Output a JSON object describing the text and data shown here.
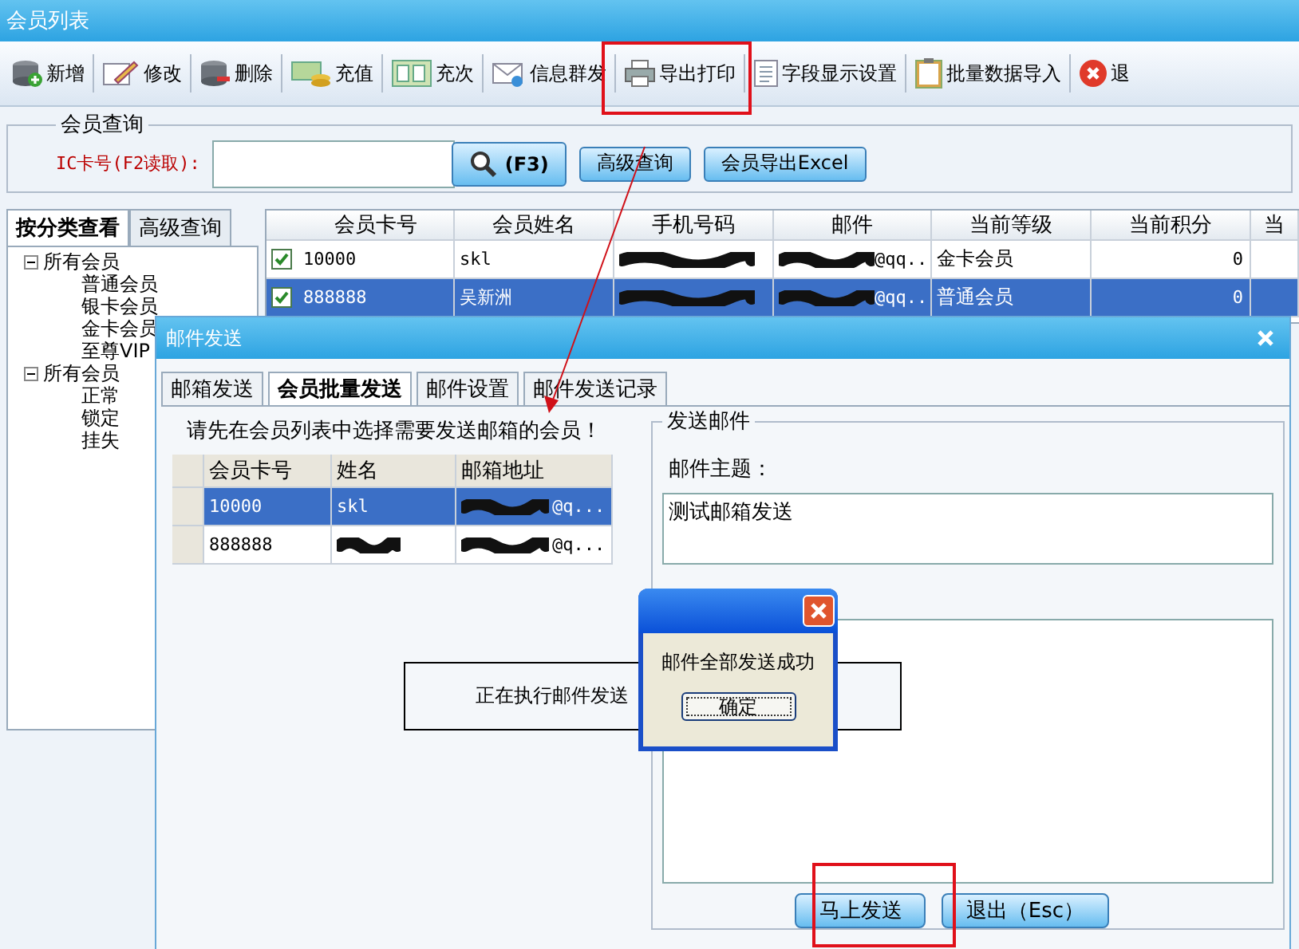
{
  "window": {
    "title": "会员列表"
  },
  "toolbar": [
    {
      "label": "新增",
      "kind": "add"
    },
    {
      "label": "修改",
      "kind": "edit"
    },
    {
      "label": "删除",
      "kind": "delete"
    },
    {
      "label": "充值",
      "kind": "money"
    },
    {
      "label": "充次",
      "kind": "cards"
    },
    {
      "label": "信息群发",
      "kind": "mail"
    },
    {
      "label": "导出打印",
      "kind": "print"
    },
    {
      "label": "字段显示设置",
      "kind": "doc"
    },
    {
      "label": "批量数据导入",
      "kind": "clipboard"
    },
    {
      "label": "退",
      "kind": "exit"
    }
  ],
  "query": {
    "title": "会员查询",
    "ic_label": "IC卡号(F2读取):",
    "search_button": "(F3)",
    "buttons": [
      "高级查询",
      "会员导出Excel"
    ]
  },
  "side_tabs": [
    {
      "label": "按分类查看",
      "selected": true
    },
    {
      "label": "高级查询",
      "selected": false
    }
  ],
  "tree": [
    {
      "label": "所有会员",
      "expanded": true,
      "children": [
        {
          "label": "普通会员"
        },
        {
          "label": "银卡会员"
        },
        {
          "label": "金卡会员"
        },
        {
          "label": "至尊VIP"
        }
      ]
    },
    {
      "label": "所有会员",
      "expanded": true,
      "children": [
        {
          "label": "正常"
        },
        {
          "label": "锁定"
        },
        {
          "label": "挂失"
        }
      ]
    }
  ],
  "table": {
    "columns": [
      "会员卡号",
      "会员姓名",
      "手机号码",
      "邮件",
      "当前等级",
      "当前积分",
      "当"
    ],
    "rows": [
      {
        "checked": true,
        "selected": false,
        "card": "10000",
        "name": "skl",
        "email": "@qq...",
        "level": "金卡会员",
        "points": "0"
      },
      {
        "checked": true,
        "selected": true,
        "card": "888888",
        "name": "吴新洲",
        "email": "@qq...",
        "level": "普通会员",
        "points": "0"
      }
    ]
  },
  "dialog": {
    "title": "邮件发送",
    "tabs": [
      {
        "label": "邮箱发送",
        "selected": false
      },
      {
        "label": "会员批量发送",
        "selected": true
      },
      {
        "label": "邮件设置",
        "selected": false
      },
      {
        "label": "邮件发送记录",
        "selected": false
      }
    ],
    "instruction": "请先在会员列表中选择需要发送邮箱的会员！",
    "grid": {
      "columns": [
        "会员卡号",
        "姓名",
        "邮箱地址"
      ],
      "rows": [
        {
          "selected": true,
          "card": "10000",
          "name": "skl",
          "email": "@q..."
        },
        {
          "selected": false,
          "card": "888888",
          "email": "@q..."
        }
      ]
    },
    "send_group": {
      "title": "发送邮件",
      "subject_label": "邮件主题：",
      "subject": "测试邮箱发送"
    },
    "buttons": [
      "马上发送",
      "退出（Esc）"
    ]
  },
  "progress": {
    "text": "正在执行邮件发送"
  },
  "message_box": {
    "text": "邮件全部发送成功",
    "button": "确定"
  }
}
